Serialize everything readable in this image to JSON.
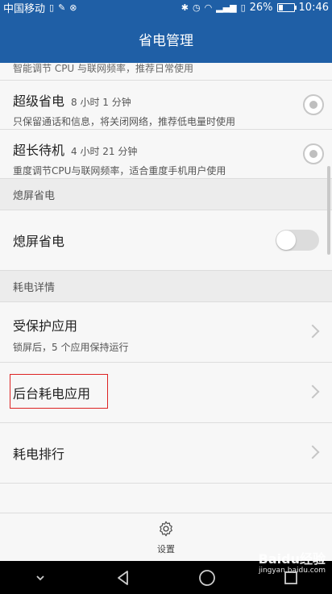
{
  "status": {
    "carrier": "中国移动",
    "battery": "26%",
    "battery_level": 0.26,
    "time": "10:46"
  },
  "header": {
    "title": "省电管理"
  },
  "modes": {
    "partial_desc": "智能调节 CPU 与联网频率，推荐日常使用",
    "items": [
      {
        "title": "超级省电",
        "time": "8 小时 1 分钟",
        "desc": "只保留通话和信息，将关闭网络，推荐低电量时使用"
      },
      {
        "title": "超长待机",
        "time": "4 小时 21 分钟",
        "desc": "重度调节CPU与联网频率，适合重度手机用户使用"
      }
    ]
  },
  "screen_off": {
    "section_label": "熄屏省电",
    "toggle_label": "熄屏省电",
    "toggle_on": false
  },
  "details": {
    "section_label": "耗电详情",
    "items": [
      {
        "title": "受保护应用",
        "desc": "锁屏后，5 个应用保持运行"
      },
      {
        "title": "后台耗电应用"
      },
      {
        "title": "耗电排行"
      }
    ]
  },
  "bottom": {
    "settings_label": "设置"
  },
  "watermark": {
    "brand": "Baidu经验",
    "url": "jingyan.baidu.com"
  }
}
